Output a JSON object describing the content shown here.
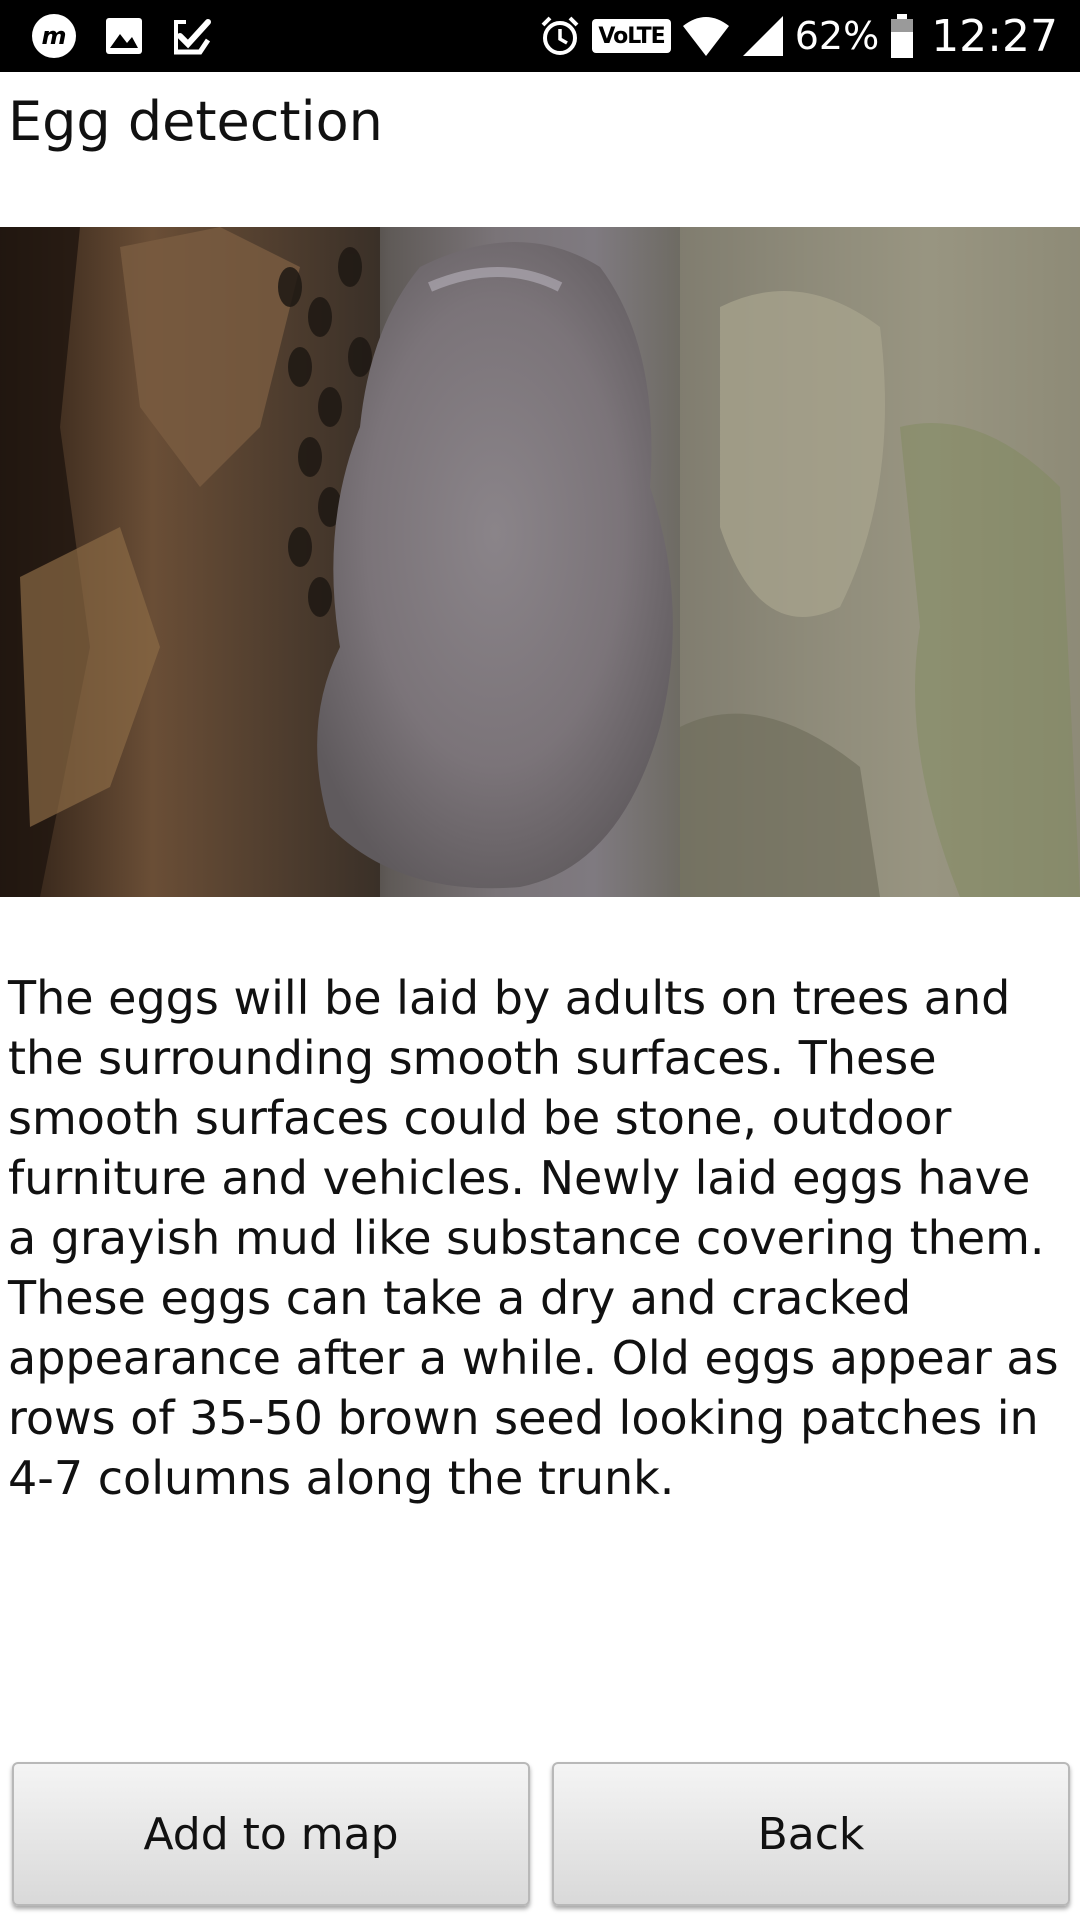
{
  "status_bar": {
    "left_icons": [
      "m-app-icon",
      "image-icon",
      "task-check-icon"
    ],
    "right_icons": [
      "alarm-icon",
      "volte-badge",
      "wifi-icon",
      "signal-icon",
      "battery-icon"
    ],
    "volte_label": "VoLTE",
    "battery_percent": "62%",
    "time": "12:27"
  },
  "page": {
    "title": "Egg detection",
    "description": "The eggs will be laid by adults on trees and the surrounding smooth surfaces. These smooth surfaces could be stone, outdoor furniture and vehicles. Newly laid eggs have a grayish mud like substance covering them. These eggs can take a dry and cracked appearance after a while. Old eggs appear as rows of 35-50 brown seed looking patches in 4-7 columns along the trunk."
  },
  "buttons": {
    "add_to_map": "Add to map",
    "back": "Back"
  },
  "colors": {
    "status_bar_bg": "#000000",
    "page_bg": "#ffffff",
    "button_bg": "#e6e6e6"
  }
}
